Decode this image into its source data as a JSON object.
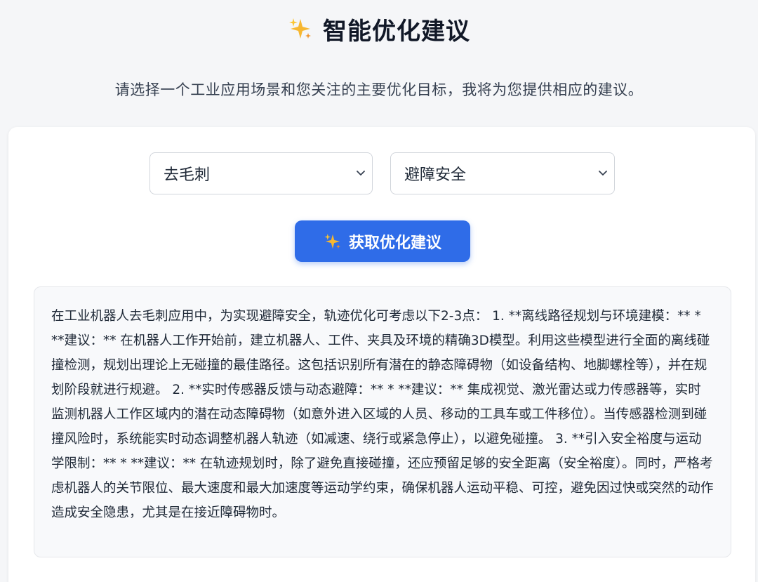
{
  "header": {
    "title": "智能优化建议",
    "title_icon": "sparkles-icon",
    "subtitle": "请选择一个工业应用场景和您关注的主要优化目标，我将为您提供相应的建议。"
  },
  "form": {
    "scenario_select": {
      "value": "去毛刺"
    },
    "goal_select": {
      "value": "避障安全"
    },
    "submit_button": {
      "label": "获取优化建议",
      "icon": "sparkles-icon"
    }
  },
  "result": {
    "text": "在工业机器人去毛刺应用中，为实现避障安全，轨迹优化可考虑以下2-3点： 1. **离线路径规划与环境建模：** * **建议：** 在机器人工作开始前，建立机器人、工件、夹具及环境的精确3D模型。利用这些模型进行全面的离线碰撞检测，规划出理论上无碰撞的最佳路径。这包括识别所有潜在的静态障碍物（如设备结构、地脚螺栓等），并在规划阶段就进行规避。 2. **实时传感器反馈与动态避障：** * **建议：** 集成视觉、激光雷达或力传感器等，实时监测机器人工作区域内的潜在动态障碍物（如意外进入区域的人员、移动的工具车或工件移位）。当传感器检测到碰撞风险时，系统能实时动态调整机器人轨迹（如减速、绕行或紧急停止），以避免碰撞。 3. **引入安全裕度与运动学限制：** * **建议：** 在轨迹规划时，除了避免直接碰撞，还应预留足够的安全距离（安全裕度）。同时，严格考虑机器人的关节限位、最大速度和最大加速度等运动学约束，确保机器人运动平稳、可控，避免因过快或突然的动作造成安全隐患，尤其是在接近障碍物时。"
  },
  "colors": {
    "accent": "#2f6ce8",
    "sparkle": "#f5a623",
    "background": "#f5f6f8"
  }
}
